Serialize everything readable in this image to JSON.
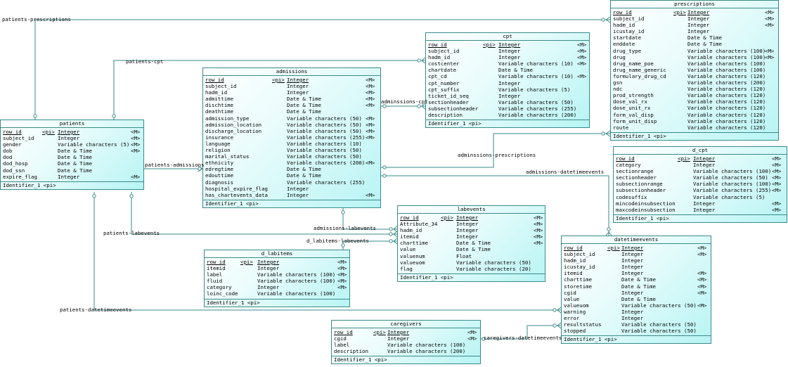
{
  "tables": [
    {
      "id": "prescriptions",
      "title": "prescriptions",
      "identifier": "Identifier_1 <pi>",
      "rows": [
        {
          "name": "row_id",
          "pi": "<pi>",
          "type": "Integer",
          "m": "<M>",
          "pk": true
        },
        {
          "name": "subject_id",
          "pi": "",
          "type": "Integer",
          "m": "<M>"
        },
        {
          "name": "hadm_id",
          "pi": "",
          "type": "Integer",
          "m": "<M>"
        },
        {
          "name": "icustay_id",
          "pi": "",
          "type": "Integer",
          "m": ""
        },
        {
          "name": "startdate",
          "pi": "",
          "type": "Date & Time",
          "m": ""
        },
        {
          "name": "enddate",
          "pi": "",
          "type": "Date & Time",
          "m": ""
        },
        {
          "name": "drug_type",
          "pi": "",
          "type": "Variable characters (100)",
          "m": "<M>"
        },
        {
          "name": "drug",
          "pi": "",
          "type": "Variable characters (100)",
          "m": "<M>"
        },
        {
          "name": "drug_name_poe",
          "pi": "",
          "type": "Variable characters (100)",
          "m": ""
        },
        {
          "name": "drug_name_generic",
          "pi": "",
          "type": "Variable characters (100)",
          "m": ""
        },
        {
          "name": "formulary_drug_cd",
          "pi": "",
          "type": "Variable characters (120)",
          "m": ""
        },
        {
          "name": "gsn",
          "pi": "",
          "type": "Variable characters (200)",
          "m": ""
        },
        {
          "name": "ndc",
          "pi": "",
          "type": "Variable characters (120)",
          "m": ""
        },
        {
          "name": "prod_strength",
          "pi": "",
          "type": "Variable characters (120)",
          "m": ""
        },
        {
          "name": "dose_val_rx",
          "pi": "",
          "type": "Variable characters (120)",
          "m": ""
        },
        {
          "name": "dose_unit_rx",
          "pi": "",
          "type": "Variable characters (120)",
          "m": ""
        },
        {
          "name": "form_val_disp",
          "pi": "",
          "type": "Variable characters (120)",
          "m": ""
        },
        {
          "name": "form_unit_disp",
          "pi": "",
          "type": "Variable characters (120)",
          "m": ""
        },
        {
          "name": "route",
          "pi": "",
          "type": "Variable characters (120)",
          "m": ""
        }
      ]
    },
    {
      "id": "cpt",
      "title": "cpt",
      "identifier": "Identifier_1 <pi>",
      "rows": [
        {
          "name": "row_id",
          "pi": "<pi>",
          "type": "Integer",
          "m": "<M>",
          "pk": true
        },
        {
          "name": "subject_id",
          "pi": "",
          "type": "Integer",
          "m": "<M>"
        },
        {
          "name": "hadm_id",
          "pi": "",
          "type": "Integer",
          "m": "<M>"
        },
        {
          "name": "costcenter",
          "pi": "",
          "type": "Variable characters (10)",
          "m": "<M>"
        },
        {
          "name": "chartdate",
          "pi": "",
          "type": "Date & Time",
          "m": ""
        },
        {
          "name": "cpt_cd",
          "pi": "",
          "type": "Variable characters (10)",
          "m": "<M>"
        },
        {
          "name": "cpt_number",
          "pi": "",
          "type": "Integer",
          "m": ""
        },
        {
          "name": "cpt_suffix",
          "pi": "",
          "type": "Variable characters (5)",
          "m": ""
        },
        {
          "name": "ticket_id_seq",
          "pi": "",
          "type": "Integer",
          "m": ""
        },
        {
          "name": "sectionheader",
          "pi": "",
          "type": "Variable characters (50)",
          "m": ""
        },
        {
          "name": "subsectionheader",
          "pi": "",
          "type": "Variable characters (255)",
          "m": ""
        },
        {
          "name": "description",
          "pi": "",
          "type": "Variable characters (200)",
          "m": ""
        }
      ]
    },
    {
      "id": "admissions",
      "title": "admissions",
      "identifier": "Identifier_1 <pi>",
      "rows": [
        {
          "name": "row_id",
          "pi": "<pi>",
          "type": "Integer",
          "m": "<M>",
          "pk": true
        },
        {
          "name": "subject_id",
          "pi": "",
          "type": "Integer",
          "m": "<M>"
        },
        {
          "name": "hadm_id",
          "pi": "",
          "type": "Integer",
          "m": "<M>"
        },
        {
          "name": "admittime",
          "pi": "",
          "type": "Date & Time",
          "m": "<M>"
        },
        {
          "name": "dischtime",
          "pi": "",
          "type": "Date & Time",
          "m": "<M>"
        },
        {
          "name": "deathtime",
          "pi": "",
          "type": "Date & Time",
          "m": ""
        },
        {
          "name": "admission_type",
          "pi": "",
          "type": "Variable characters (50)",
          "m": "<M>"
        },
        {
          "name": "admission_location",
          "pi": "",
          "type": "Variable characters (50)",
          "m": "<M>"
        },
        {
          "name": "discharge_location",
          "pi": "",
          "type": "Variable characters (50)",
          "m": "<M>"
        },
        {
          "name": "insurance",
          "pi": "",
          "type": "Variable characters (255)",
          "m": "<M>"
        },
        {
          "name": "language",
          "pi": "",
          "type": "Variable characters (10)",
          "m": ""
        },
        {
          "name": "religion",
          "pi": "",
          "type": "Variable characters (50)",
          "m": ""
        },
        {
          "name": "marital_status",
          "pi": "",
          "type": "Variable characters (50)",
          "m": ""
        },
        {
          "name": "ethnicity",
          "pi": "",
          "type": "Variable characters (200)",
          "m": "<M>"
        },
        {
          "name": "edregtime",
          "pi": "",
          "type": "Date & Time",
          "m": ""
        },
        {
          "name": "edouttime",
          "pi": "",
          "type": "Date & Time",
          "m": ""
        },
        {
          "name": "diagnosis",
          "pi": "",
          "type": "Variable characters (255)",
          "m": ""
        },
        {
          "name": "hospital_expire_flag",
          "pi": "",
          "type": "Integer",
          "m": ""
        },
        {
          "name": "has_chartevents_data",
          "pi": "",
          "type": "Integer",
          "m": "<M>"
        }
      ]
    },
    {
      "id": "patients",
      "title": "patients",
      "identifier": "Identifier_1 <pi>",
      "rows": [
        {
          "name": "row_id",
          "pi": "<pi>",
          "type": "Integer",
          "m": "<M>",
          "pk": true
        },
        {
          "name": "subject_id",
          "pi": "",
          "type": "Integer",
          "m": "<M>"
        },
        {
          "name": "gender",
          "pi": "",
          "type": "Variable characters (5)",
          "m": "<M>"
        },
        {
          "name": "dob",
          "pi": "",
          "type": "Date & Time",
          "m": "<M>"
        },
        {
          "name": "dod",
          "pi": "",
          "type": "Date & Time",
          "m": ""
        },
        {
          "name": "dod_hosp",
          "pi": "",
          "type": "Date & Time",
          "m": ""
        },
        {
          "name": "dod_ssn",
          "pi": "",
          "type": "Date & Time",
          "m": ""
        },
        {
          "name": "expire_flag",
          "pi": "",
          "type": "Integer",
          "m": "<M>"
        }
      ]
    },
    {
      "id": "d_cpt",
      "title": "d_cpt",
      "identifier": "Identifier_1 <pi>",
      "rows": [
        {
          "name": "row_id",
          "pi": "<pi>",
          "type": "Integer",
          "m": "<M>",
          "pk": true
        },
        {
          "name": "category",
          "pi": "",
          "type": "Integer",
          "m": "<M>"
        },
        {
          "name": "sectionrange",
          "pi": "",
          "type": "Variable characters (100)",
          "m": "<M>"
        },
        {
          "name": "sectionheader",
          "pi": "",
          "type": "Variable characters (50)",
          "m": "<M>"
        },
        {
          "name": "subsectionrange",
          "pi": "",
          "type": "Variable characters (100)",
          "m": "<M>"
        },
        {
          "name": "subsectionheader",
          "pi": "",
          "type": "Variable characters (255)",
          "m": "<M>"
        },
        {
          "name": "codesuffix",
          "pi": "",
          "type": "Variable characters (5)",
          "m": ""
        },
        {
          "name": "mincodeinsubsection",
          "pi": "",
          "type": "Integer",
          "m": "<M>"
        },
        {
          "name": "maxcodeinsubsection",
          "pi": "",
          "type": "Integer",
          "m": "<M>"
        }
      ]
    },
    {
      "id": "labevents",
      "title": "labevents",
      "identifier": "Identifier_1 <pi>",
      "rows": [
        {
          "name": "row_id",
          "pi": "<pi>",
          "type": "Integer",
          "m": "<M>",
          "pk": true
        },
        {
          "name": "Attribute_34",
          "pi": "",
          "type": "Integer",
          "m": "<M>"
        },
        {
          "name": "hadm_id",
          "pi": "",
          "type": "Integer",
          "m": "<M>"
        },
        {
          "name": "itemid",
          "pi": "",
          "type": "Integer",
          "m": "<M>"
        },
        {
          "name": "charttime",
          "pi": "",
          "type": "Date & Time",
          "m": "<M>"
        },
        {
          "name": "value",
          "pi": "",
          "type": "Date & Time",
          "m": ""
        },
        {
          "name": "valuenum",
          "pi": "",
          "type": "Float",
          "m": ""
        },
        {
          "name": "valueuom",
          "pi": "",
          "type": "Variable characters (50)",
          "m": ""
        },
        {
          "name": "flag",
          "pi": "",
          "type": "Variable characters (20)",
          "m": ""
        }
      ]
    },
    {
      "id": "d_labitems",
      "title": "d_labitems",
      "identifier": "Identifier_1 <pi>",
      "rows": [
        {
          "name": "row_id",
          "pi": "<pi>",
          "type": "Integer",
          "m": "<M>",
          "pk": true
        },
        {
          "name": "itemid",
          "pi": "",
          "type": "Integer",
          "m": "<M>"
        },
        {
          "name": "label",
          "pi": "",
          "type": "Variable characters (100)",
          "m": "<M>"
        },
        {
          "name": "fluid",
          "pi": "",
          "type": "Variable characters (100)",
          "m": "<M>"
        },
        {
          "name": "category",
          "pi": "",
          "type": "Integer",
          "m": "<M>"
        },
        {
          "name": "loinc_code",
          "pi": "",
          "type": "Variable characters (100)",
          "m": ""
        }
      ]
    },
    {
      "id": "datetimeevents",
      "title": "datetimeevents",
      "identifier": "Identifier_1 <pi>",
      "rows": [
        {
          "name": "row_id",
          "pi": "<pi>",
          "type": "Integer",
          "m": "<M>",
          "pk": true
        },
        {
          "name": "subject_id",
          "pi": "",
          "type": "Integer",
          "m": "<M>"
        },
        {
          "name": "hadm_id",
          "pi": "",
          "type": "Integer",
          "m": ""
        },
        {
          "name": "icustay_id",
          "pi": "",
          "type": "Integer",
          "m": ""
        },
        {
          "name": "itemid",
          "pi": "",
          "type": "Integer",
          "m": "<M>"
        },
        {
          "name": "charttime",
          "pi": "",
          "type": "Date & Time",
          "m": "<M>"
        },
        {
          "name": "storetime",
          "pi": "",
          "type": "Date & Time",
          "m": "<M>"
        },
        {
          "name": "cgid",
          "pi": "",
          "type": "Integer",
          "m": "<M>"
        },
        {
          "name": "value",
          "pi": "",
          "type": "Date & Time",
          "m": ""
        },
        {
          "name": "valueuom",
          "pi": "",
          "type": "Variable characters (50)",
          "m": "<M>"
        },
        {
          "name": "warning",
          "pi": "",
          "type": "Integer",
          "m": ""
        },
        {
          "name": "error",
          "pi": "",
          "type": "Integer",
          "m": ""
        },
        {
          "name": "resultstatus",
          "pi": "",
          "type": "Variable characters (50)",
          "m": ""
        },
        {
          "name": "stopped",
          "pi": "",
          "type": "Variable characters (50)",
          "m": ""
        }
      ]
    },
    {
      "id": "caregivers",
      "title": "caregivers",
      "identifier": "Identifier_1 <pi>",
      "rows": [
        {
          "name": "row_id",
          "pi": "<pi>",
          "type": "Integer",
          "m": "<M>",
          "pk": true
        },
        {
          "name": "cgid",
          "pi": "",
          "type": "Integer",
          "m": "<M>"
        },
        {
          "name": "label",
          "pi": "",
          "type": "Variable characters (100)",
          "m": ""
        },
        {
          "name": "description",
          "pi": "",
          "type": "Variable characters (200)",
          "m": ""
        }
      ]
    }
  ],
  "relationships": [
    {
      "id": "patients-prescriptions",
      "label": "patients-prescriptions"
    },
    {
      "id": "patients-cpt",
      "label": "patients-cpt"
    },
    {
      "id": "patients-admissions",
      "label": "patients-admissions"
    },
    {
      "id": "adminssions-cpt",
      "label": "adminssions-cpt"
    },
    {
      "id": "adminssions-prescriptions",
      "label": "adminssions-prescriptions"
    },
    {
      "id": "admissions-datetimeevents",
      "label": "admissions-datetimeevents"
    },
    {
      "id": "admissions-labevents",
      "label": "admissions-labevents"
    },
    {
      "id": "patients-labevents",
      "label": "patients-labevents"
    },
    {
      "id": "d_labitems-labevents",
      "label": "d_labitems-labevents"
    },
    {
      "id": "patients-datetimeevents",
      "label": "patients-datetimeevents"
    },
    {
      "id": "caregivers-datetimeevents",
      "label": "caregivers-datetimeevents"
    }
  ],
  "colors": {
    "border": "#3a8a8a",
    "line": "#3a8a8a",
    "fill_light": "#ffffff",
    "fill_dark": "#b8f4f4"
  }
}
